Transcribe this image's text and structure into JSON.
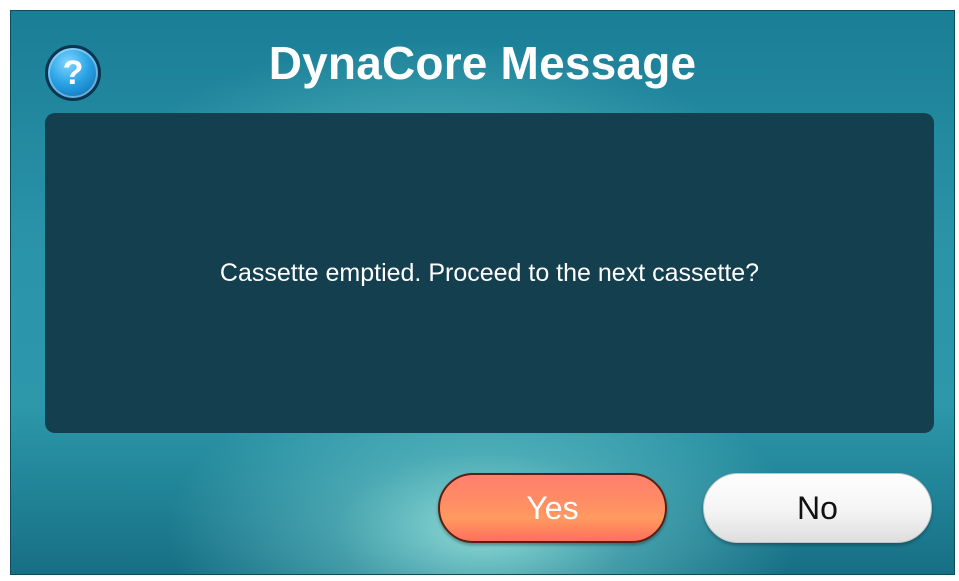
{
  "dialog": {
    "title": "DynaCore Message",
    "icon": "question-mark-icon",
    "message": "Cassette emptied. Proceed to the next cassette?",
    "buttons": {
      "yes_label": "Yes",
      "no_label": "No"
    }
  },
  "colors": {
    "background": "#2a93a8",
    "panel": "#143f4e",
    "yes_button": "#ff8a66",
    "no_button": "#f4f4f4"
  }
}
